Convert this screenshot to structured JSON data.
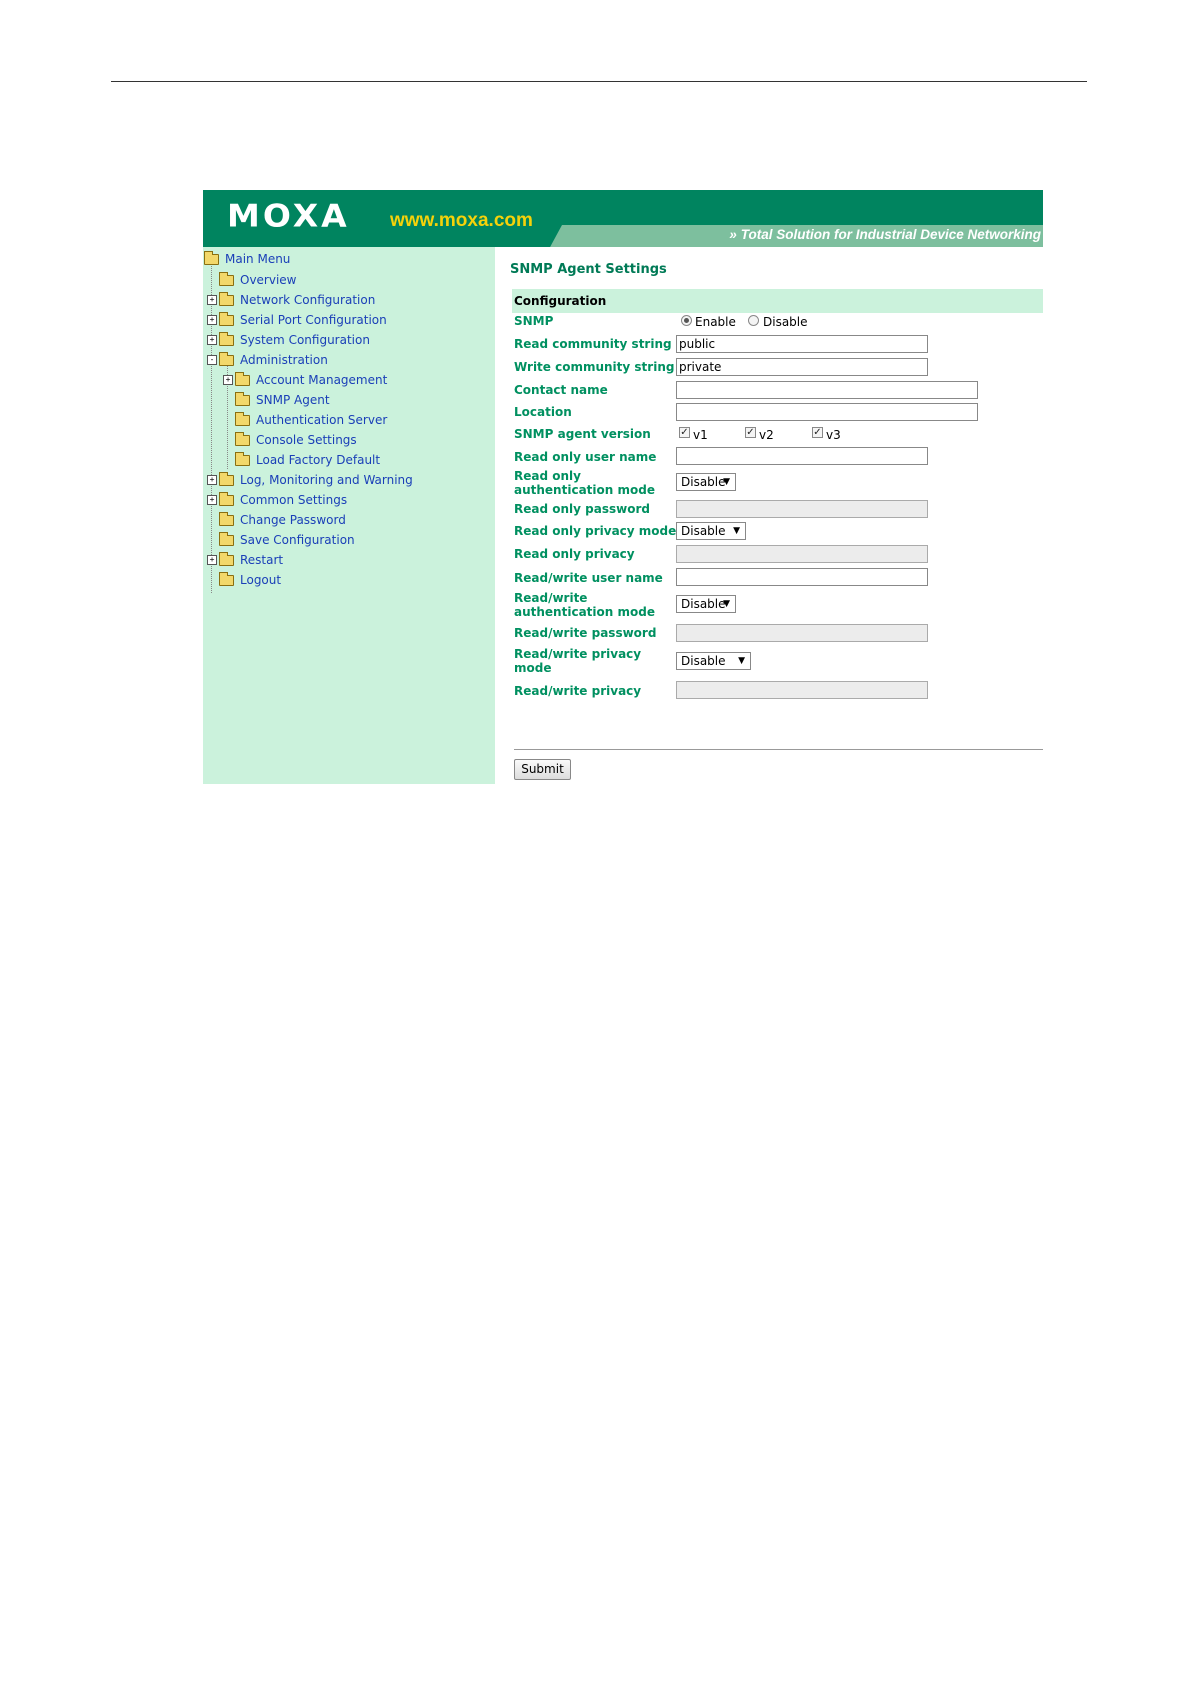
{
  "header": {
    "logo_text": "MOXA",
    "url_text": "www.moxa.com",
    "tagline": "Total Solution for Industrial Device Networking",
    "colors": {
      "banner": "#00845f",
      "strip": "#7dbf9e",
      "url": "#f5d20a",
      "sidebar": "#cbf2dc",
      "label_green": "#009060"
    }
  },
  "sidebar": {
    "root": "Main Menu",
    "items": [
      {
        "label": "Overview",
        "expander": ""
      },
      {
        "label": "Network Configuration",
        "expander": "+"
      },
      {
        "label": "Serial Port Configuration",
        "expander": "+"
      },
      {
        "label": "System Configuration",
        "expander": "+"
      },
      {
        "label": "Administration",
        "expander": "-"
      },
      {
        "label": "Account Management",
        "expander": "+"
      },
      {
        "label": "SNMP Agent",
        "expander": ""
      },
      {
        "label": "Authentication Server",
        "expander": ""
      },
      {
        "label": "Console Settings",
        "expander": ""
      },
      {
        "label": "Load Factory Default",
        "expander": ""
      },
      {
        "label": "Log, Monitoring and Warning",
        "expander": "+"
      },
      {
        "label": "Common Settings",
        "expander": "+"
      },
      {
        "label": "Change Password",
        "expander": ""
      },
      {
        "label": "Save Configuration",
        "expander": ""
      },
      {
        "label": "Restart",
        "expander": "+"
      },
      {
        "label": "Logout",
        "expander": ""
      }
    ]
  },
  "main": {
    "title": "SNMP Agent Settings",
    "section": "Configuration",
    "fields": {
      "snmp": {
        "label": "SNMP",
        "enable": "Enable",
        "disable": "Disable",
        "selected": "Enable"
      },
      "read_community": {
        "label": "Read community string",
        "value": "public"
      },
      "write_community": {
        "label": "Write community string",
        "value": "private"
      },
      "contact_name": {
        "label": "Contact name",
        "value": ""
      },
      "location": {
        "label": "Location",
        "value": ""
      },
      "agent_version": {
        "label": "SNMP agent version",
        "v1": "v1",
        "v2": "v2",
        "v3": "v3",
        "checked": [
          "v1",
          "v2",
          "v3"
        ]
      },
      "ro_user": {
        "label": "Read only user name",
        "value": ""
      },
      "ro_auth_mode": {
        "label_line1": "Read only",
        "label_line2": "authentication mode",
        "value": "Disable"
      },
      "ro_password": {
        "label": "Read only password",
        "value": ""
      },
      "ro_privacy_mode": {
        "label": "Read only privacy mode",
        "value": "Disable"
      },
      "ro_privacy": {
        "label": "Read only privacy",
        "value": ""
      },
      "rw_user": {
        "label": "Read/write user name",
        "value": ""
      },
      "rw_auth_mode": {
        "label_line1": "Read/write",
        "label_line2": "authentication mode",
        "value": "Disable"
      },
      "rw_password": {
        "label": "Read/write password",
        "value": ""
      },
      "rw_privacy_mode": {
        "label_line1": "Read/write privacy",
        "label_line2": "mode",
        "value": "Disable"
      },
      "rw_privacy": {
        "label": "Read/write privacy",
        "value": ""
      }
    },
    "submit_label": "Submit"
  }
}
